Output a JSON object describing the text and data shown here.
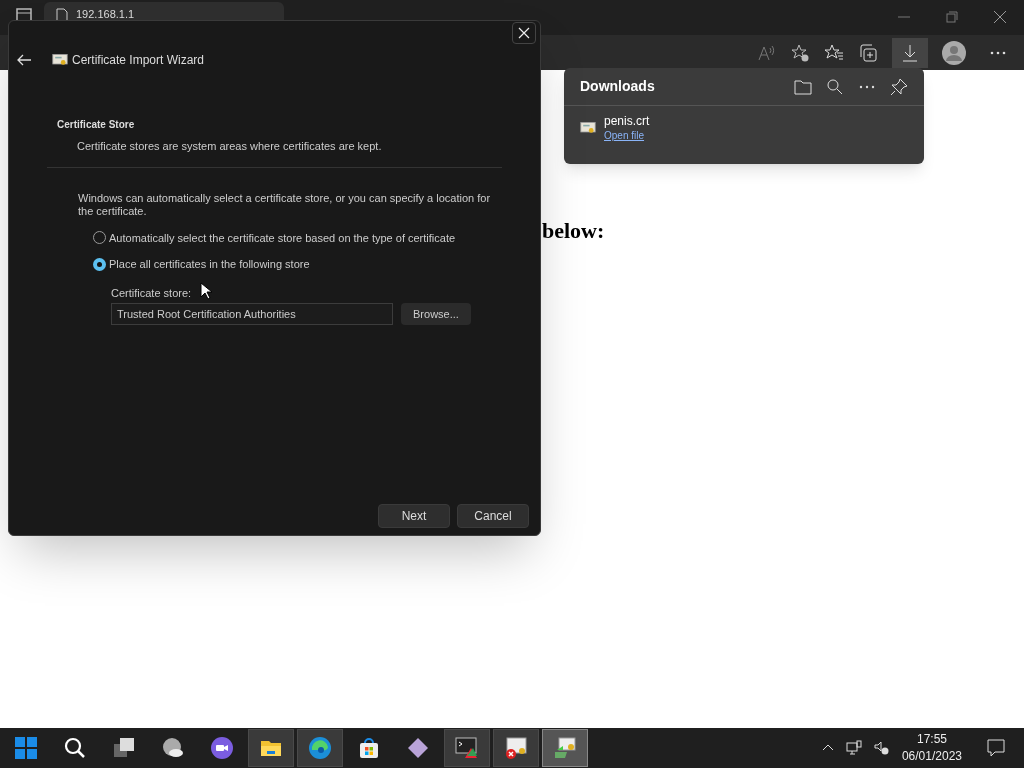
{
  "browser": {
    "tab_title": "192.168.1.1"
  },
  "page": {
    "heading_fragment": "below:"
  },
  "downloads": {
    "title": "Downloads",
    "items": [
      {
        "name": "penis.crt",
        "action": "Open file"
      }
    ]
  },
  "dialog": {
    "title": "Certificate Import Wizard",
    "section_title": "Certificate Store",
    "section_subtitle": "Certificate stores are system areas where certificates are kept.",
    "description": "Windows can automatically select a certificate store, or you can specify a location for the certificate.",
    "options": [
      {
        "label": "Automatically select the certificate store based on the type of certificate",
        "selected": false
      },
      {
        "label": "Place all certificates in the following store",
        "selected": true
      }
    ],
    "store_label": "Certificate store:",
    "store_value": "Trusted Root Certification Authorities",
    "browse": "Browse...",
    "buttons": [
      {
        "label": "Next"
      },
      {
        "label": "Cancel"
      }
    ]
  },
  "taskbar": {
    "apps": [
      {
        "kind": "start",
        "running": false,
        "selected": false
      },
      {
        "kind": "search",
        "running": false,
        "selected": false
      },
      {
        "kind": "taskview",
        "running": false,
        "selected": false
      },
      {
        "kind": "widgets",
        "running": false,
        "selected": false
      },
      {
        "kind": "chat",
        "running": false,
        "selected": false
      },
      {
        "kind": "explorer",
        "running": true,
        "selected": false
      },
      {
        "kind": "edge",
        "running": true,
        "selected": false
      },
      {
        "kind": "store",
        "running": false,
        "selected": false
      },
      {
        "kind": "gem",
        "running": false,
        "selected": false
      },
      {
        "kind": "terminal",
        "running": true,
        "selected": false
      },
      {
        "kind": "certmgr",
        "running": true,
        "selected": false
      },
      {
        "kind": "wizard",
        "running": true,
        "selected": true
      }
    ],
    "time": "17:55",
    "date": "06/01/2023"
  }
}
